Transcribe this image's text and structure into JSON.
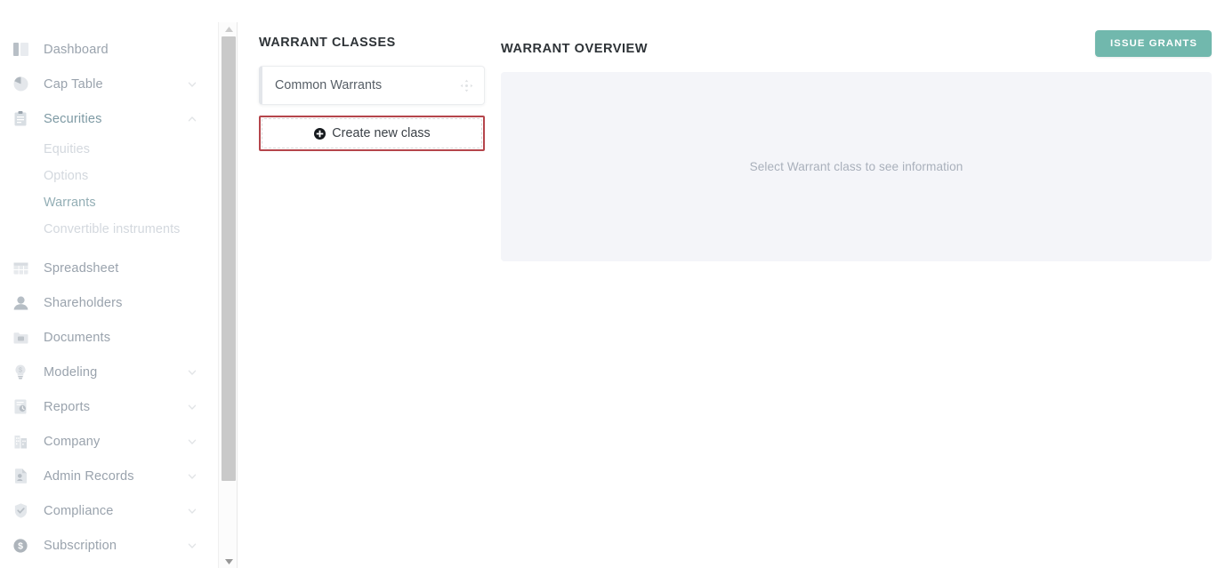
{
  "sidebar": {
    "items": [
      {
        "label": "Dashboard",
        "icon": "dashboard-icon",
        "expandable": false,
        "active": false
      },
      {
        "label": "Cap Table",
        "icon": "pie-chart-icon",
        "expandable": true,
        "expanded": false,
        "active": false
      },
      {
        "label": "Securities",
        "icon": "clipboard-icon",
        "expandable": true,
        "expanded": true,
        "active": true
      },
      {
        "label": "Spreadsheet",
        "icon": "grid-icon",
        "expandable": false,
        "active": false
      },
      {
        "label": "Shareholders",
        "icon": "user-icon",
        "expandable": false,
        "active": false
      },
      {
        "label": "Documents",
        "icon": "folder-icon",
        "expandable": false,
        "active": false
      },
      {
        "label": "Modeling",
        "icon": "lightbulb-icon",
        "expandable": true,
        "expanded": false,
        "active": false
      },
      {
        "label": "Reports",
        "icon": "report-icon",
        "expandable": true,
        "expanded": false,
        "active": false
      },
      {
        "label": "Company",
        "icon": "building-icon",
        "expandable": true,
        "expanded": false,
        "active": false
      },
      {
        "label": "Admin Records",
        "icon": "admin-records-icon",
        "expandable": true,
        "expanded": false,
        "active": false
      },
      {
        "label": "Compliance",
        "icon": "shield-check-icon",
        "expandable": true,
        "expanded": false,
        "active": false
      },
      {
        "label": "Subscription",
        "icon": "dollar-circle-icon",
        "expandable": true,
        "expanded": false,
        "active": false
      }
    ],
    "securities_subitems": [
      {
        "label": "Equities",
        "active": false
      },
      {
        "label": "Options",
        "active": false
      },
      {
        "label": "Warrants",
        "active": true
      },
      {
        "label": "Convertible instruments",
        "active": false
      }
    ]
  },
  "classes_panel": {
    "title": "WARRANT CLASSES",
    "classes": [
      {
        "label": "Common Warrants",
        "handle_icon": "move-handle-icon"
      }
    ],
    "create_button": {
      "label": "Create new class",
      "icon": "plus-circle-icon",
      "highlight_color": "#b5454b"
    }
  },
  "overview": {
    "title": "WARRANT OVERVIEW",
    "issue_button_label": "ISSUE GRANTS",
    "issue_button_color": "#71b8ad",
    "empty_state_text": "Select Warrant class to see information"
  },
  "scrollbar": {
    "up_arrow": "scroll-up-arrow-icon",
    "down_arrow": "scroll-down-arrow-icon"
  }
}
